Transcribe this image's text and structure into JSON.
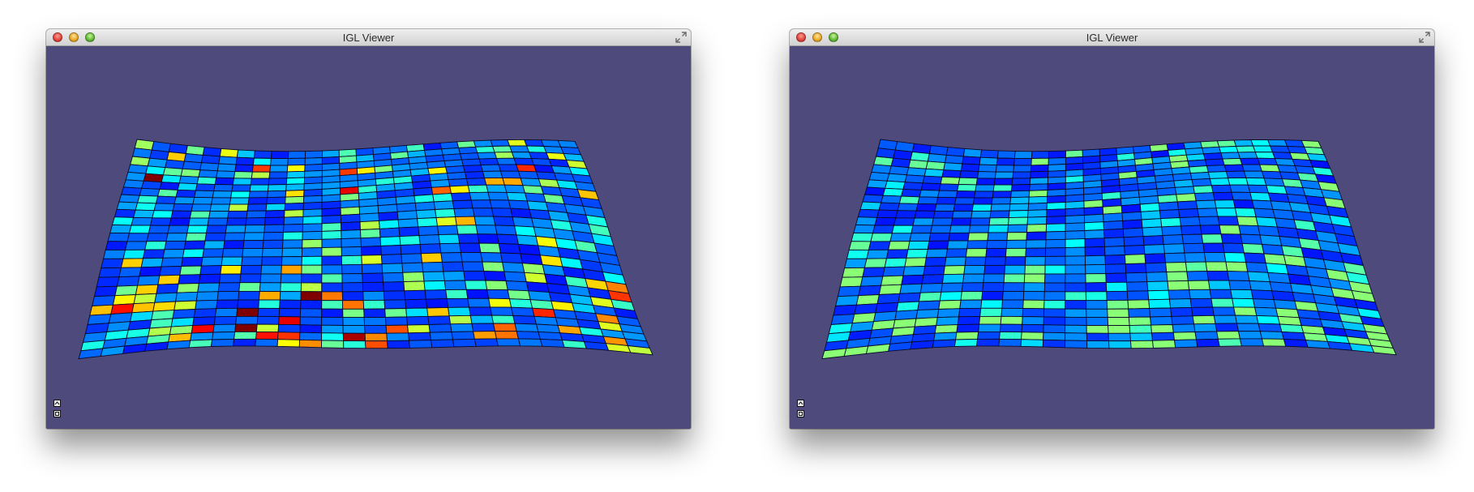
{
  "windows": [
    {
      "title": "IGL Viewer",
      "mesh": {
        "colormap": "jet",
        "max_level": 1.0,
        "heat_seed": 7
      }
    },
    {
      "title": "IGL Viewer",
      "mesh": {
        "colormap": "jet",
        "max_level": 0.45,
        "heat_seed": 11
      }
    }
  ],
  "icons": {
    "close": "close-icon",
    "minimize": "minimize-icon",
    "zoom": "zoom-icon",
    "fullscreen": "fullscreen-icon",
    "panel_toggle": "chevron-up-icon",
    "panel_settings": "settings-icon"
  },
  "colors": {
    "viewport_background": "#4e4b7c",
    "edge_color": "#0a0a28"
  }
}
